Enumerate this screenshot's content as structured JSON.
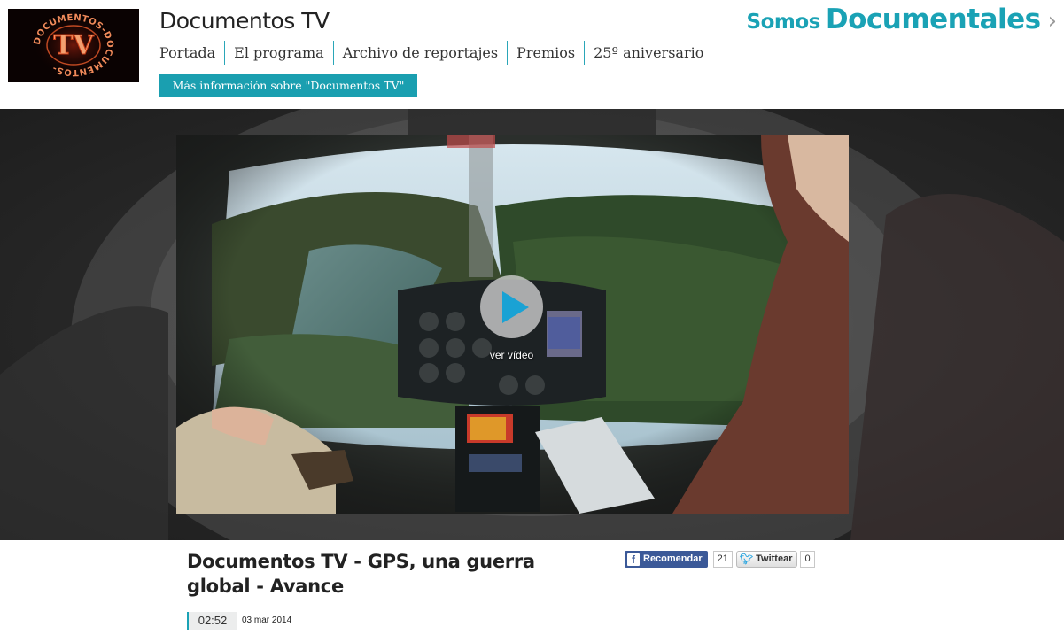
{
  "header": {
    "logo_text": "DOCUMENTOS-DOCUMENTOS-TV",
    "brand_title": "Documentos TV",
    "nav": [
      {
        "label": "Portada"
      },
      {
        "label": "El programa"
      },
      {
        "label": "Archivo de reportajes"
      },
      {
        "label": "Premios"
      },
      {
        "label": "25º aniversario"
      }
    ],
    "more_info_label": "Más información sobre \"Documentos TV\"",
    "somos_word1": "Somos",
    "somos_word2": "Documentales"
  },
  "player": {
    "play_label": "ver vídeo"
  },
  "video": {
    "title": "Documentos TV - GPS, una guerra global - Avance",
    "duration": "02:52",
    "date": "03 mar 2014"
  },
  "social": {
    "facebook_label": "Recomendar",
    "facebook_count": "21",
    "twitter_label": "Twittear",
    "twitter_count": "0"
  },
  "colors": {
    "accent": "#1aa2b5",
    "facebook": "#3b5998",
    "play": "#1aa2d4"
  }
}
